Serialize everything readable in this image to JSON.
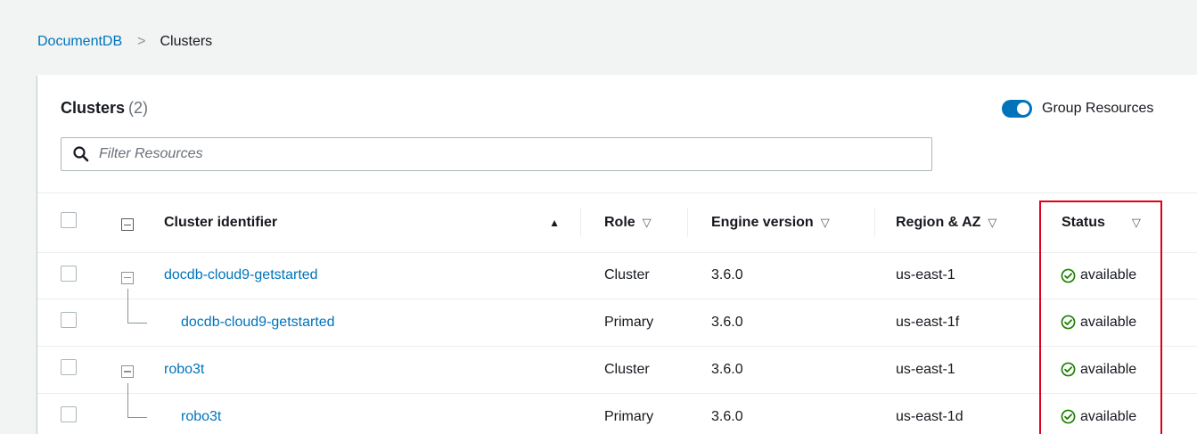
{
  "breadcrumb": {
    "root": "DocumentDB",
    "separator": ">",
    "current": "Clusters"
  },
  "panel": {
    "title": "Clusters",
    "count": "(2)",
    "group_toggle": {
      "label": "Group Resources",
      "on": true
    },
    "filter": {
      "placeholder": "Filter Resources",
      "value": ""
    }
  },
  "table": {
    "headers": {
      "identifier": "Cluster identifier",
      "identifier_sort": "▲",
      "role": "Role",
      "engine": "Engine version",
      "region": "Region & AZ",
      "status": "Status",
      "sort_down": "▽"
    },
    "rows": [
      {
        "identifier": "docdb-cloud9-getstarted",
        "role": "Cluster",
        "engine": "3.6.0",
        "region": "us-east-1",
        "status": "available"
      },
      {
        "identifier": "docdb-cloud9-getstarted",
        "role": "Primary",
        "engine": "3.6.0",
        "region": "us-east-1f",
        "status": "available"
      },
      {
        "identifier": "robo3t",
        "role": "Cluster",
        "engine": "3.6.0",
        "region": "us-east-1",
        "status": "available"
      },
      {
        "identifier": "robo3t",
        "role": "Primary",
        "engine": "3.6.0",
        "region": "us-east-1d",
        "status": "available"
      }
    ]
  },
  "colors": {
    "link": "#0073bb",
    "status_ok": "#1d8102",
    "highlight": "#e0001b"
  },
  "icons": {
    "search": "search-icon",
    "status": "check-circle-icon"
  }
}
